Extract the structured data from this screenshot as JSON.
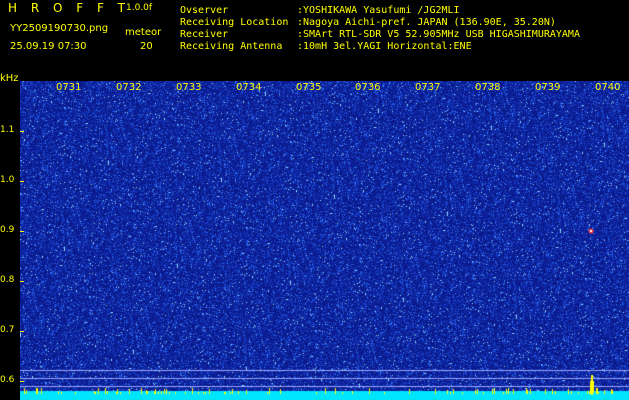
{
  "header": {
    "title": "H R O F F T",
    "version": "1.0.0f",
    "filename": "YY2509190730.png",
    "datetime": "25.09.19 07:30",
    "meteor_label": "meteor",
    "meteor_count": "20",
    "info": [
      {
        "key": "Ovserver",
        "value": ":YOSHIKAWA Yasufumi /JG2MLI"
      },
      {
        "key": "Receiving Location",
        "value": ":Nagoya Aichi-pref. JAPAN (136.90E, 35.20N)"
      },
      {
        "key": "Receiver",
        "value": ":SMArt RTL-SDR V5 52.905MHz USB HIGASHIMURAYAMA"
      },
      {
        "key": "Receiving Antenna",
        "value": ":10mH 3el.YAGI Horizontal:ENE"
      }
    ]
  },
  "axis": {
    "y_unit": "kHz",
    "y_ticks": [
      "1.1",
      "1.0",
      "0.9",
      "0.8",
      "0.7",
      "0.6"
    ],
    "x_ticks": [
      "0731",
      "0732",
      "0733",
      "0734",
      "0735",
      "0736",
      "0737",
      "0738",
      "0739",
      "0740"
    ]
  },
  "colors": {
    "background": "#0b1a8a",
    "label": "#ffff00",
    "baseline": "#00e5ff",
    "noise": "#3a7bff",
    "ping": "#ff3030"
  }
}
